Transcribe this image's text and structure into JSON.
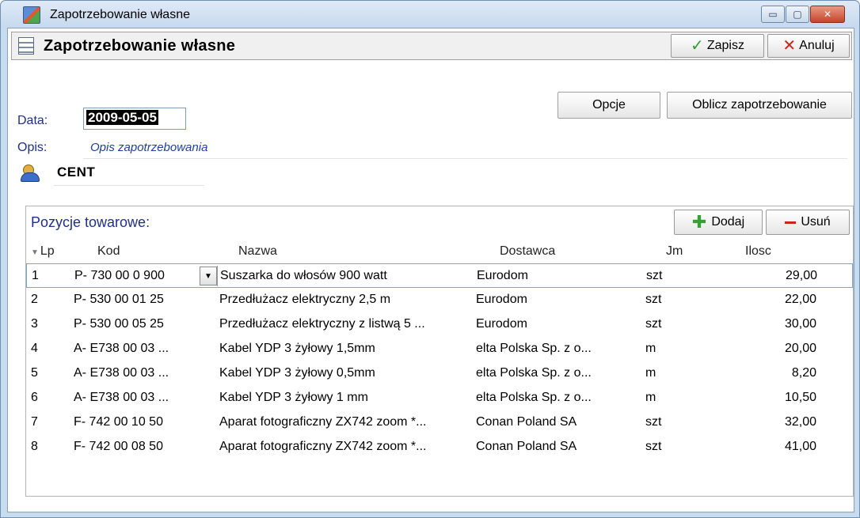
{
  "window": {
    "title": "Zapotrzebowanie własne",
    "controls": {
      "minimize": "▭",
      "maximize": "▢",
      "close": "✕"
    }
  },
  "header": {
    "title": "Zapotrzebowanie własne",
    "save_label": "Zapisz",
    "cancel_label": "Anuluj"
  },
  "form": {
    "date_label": "Data:",
    "date_value": "2009-05-05",
    "desc_label": "Opis:",
    "desc_value": "Opis zapotrzebowania",
    "options_label": "Opcje",
    "compute_label": "Oblicz zapotrzebowanie",
    "company": "CENT"
  },
  "grid": {
    "title": "Pozycje towarowe:",
    "add_label": "Dodaj",
    "remove_label": "Usuń",
    "columns": {
      "lp": "Lp",
      "kod": "Kod",
      "nazwa": "Nazwa",
      "dostawca": "Dostawca",
      "jm": "Jm",
      "ilosc": "Ilosc"
    },
    "rows": [
      {
        "lp": "1",
        "kod": "P- 730 00 0 900",
        "nazwa": "Suszarka do włosów 900 watt",
        "dostawca": "Eurodom",
        "jm": "szt",
        "ilosc": "29,00"
      },
      {
        "lp": "2",
        "kod": "P- 530 00 01 25",
        "nazwa": "Przedłużacz elektryczny 2,5 m",
        "dostawca": "Eurodom",
        "jm": "szt",
        "ilosc": "22,00"
      },
      {
        "lp": "3",
        "kod": "P- 530 00 05 25",
        "nazwa": "Przedłużacz elektryczny z listwą 5 ...",
        "dostawca": "Eurodom",
        "jm": "szt",
        "ilosc": "30,00"
      },
      {
        "lp": "4",
        "kod": "A- E738 00 03 ...",
        "nazwa": "Kabel YDP 3 żyłowy 1,5mm",
        "dostawca": "elta Polska Sp. z o...",
        "jm": "m",
        "ilosc": "20,00"
      },
      {
        "lp": "5",
        "kod": "A- E738 00 03 ...",
        "nazwa": "Kabel YDP 3 żyłowy 0,5mm",
        "dostawca": "elta Polska Sp. z o...",
        "jm": "m",
        "ilosc": "8,20"
      },
      {
        "lp": "6",
        "kod": "A- E738 00 03 ...",
        "nazwa": "Kabel YDP 3 żyłowy 1 mm",
        "dostawca": "elta Polska Sp. z o...",
        "jm": "m",
        "ilosc": "10,50"
      },
      {
        "lp": "7",
        "kod": "F- 742 00 10 50",
        "nazwa": "Aparat fotograficzny ZX742 zoom *...",
        "dostawca": "Conan Poland SA",
        "jm": "szt",
        "ilosc": "32,00"
      },
      {
        "lp": "8",
        "kod": "F- 742 00 08 50",
        "nazwa": "Aparat fotograficzny ZX742 zoom *...",
        "dostawca": "Conan Poland SA",
        "jm": "szt",
        "ilosc": "41,00"
      }
    ]
  }
}
